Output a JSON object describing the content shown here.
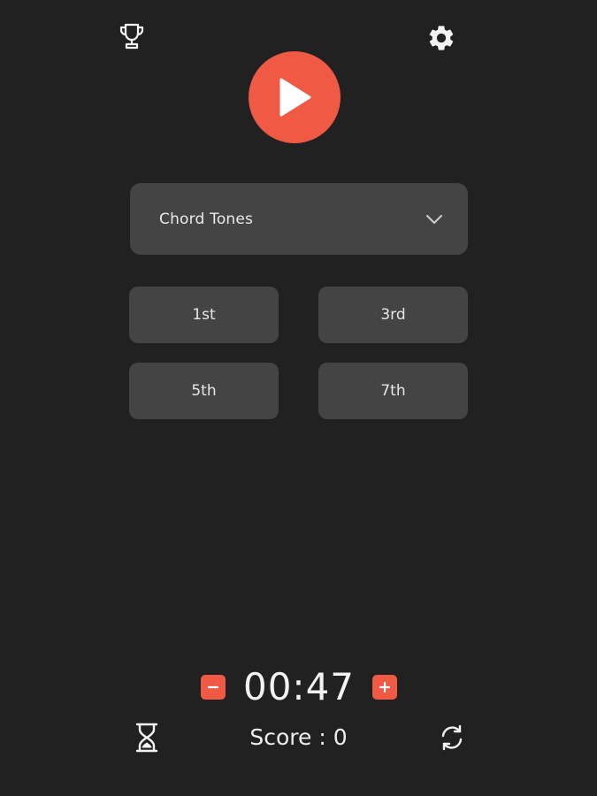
{
  "header": {
    "leaderboard_icon": "trophy-icon",
    "settings_icon": "gear-icon"
  },
  "play": {
    "icon": "play-icon"
  },
  "mode_select": {
    "selected": "Chord Tones",
    "icon": "chevron-down-icon"
  },
  "answers": [
    {
      "label": "1st"
    },
    {
      "label": "3rd"
    },
    {
      "label": "5th"
    },
    {
      "label": "7th"
    }
  ],
  "timer": {
    "value": "00:47",
    "decrease_icon": "minus-icon",
    "increase_icon": "plus-icon"
  },
  "footer": {
    "score_text": "Score : 0",
    "timer_mode_icon": "hourglass-icon",
    "restart_icon": "refresh-icon"
  },
  "colors": {
    "background": "#212121",
    "accent": "#f05a45",
    "surface": "#444444",
    "text": "#eeeeee"
  }
}
